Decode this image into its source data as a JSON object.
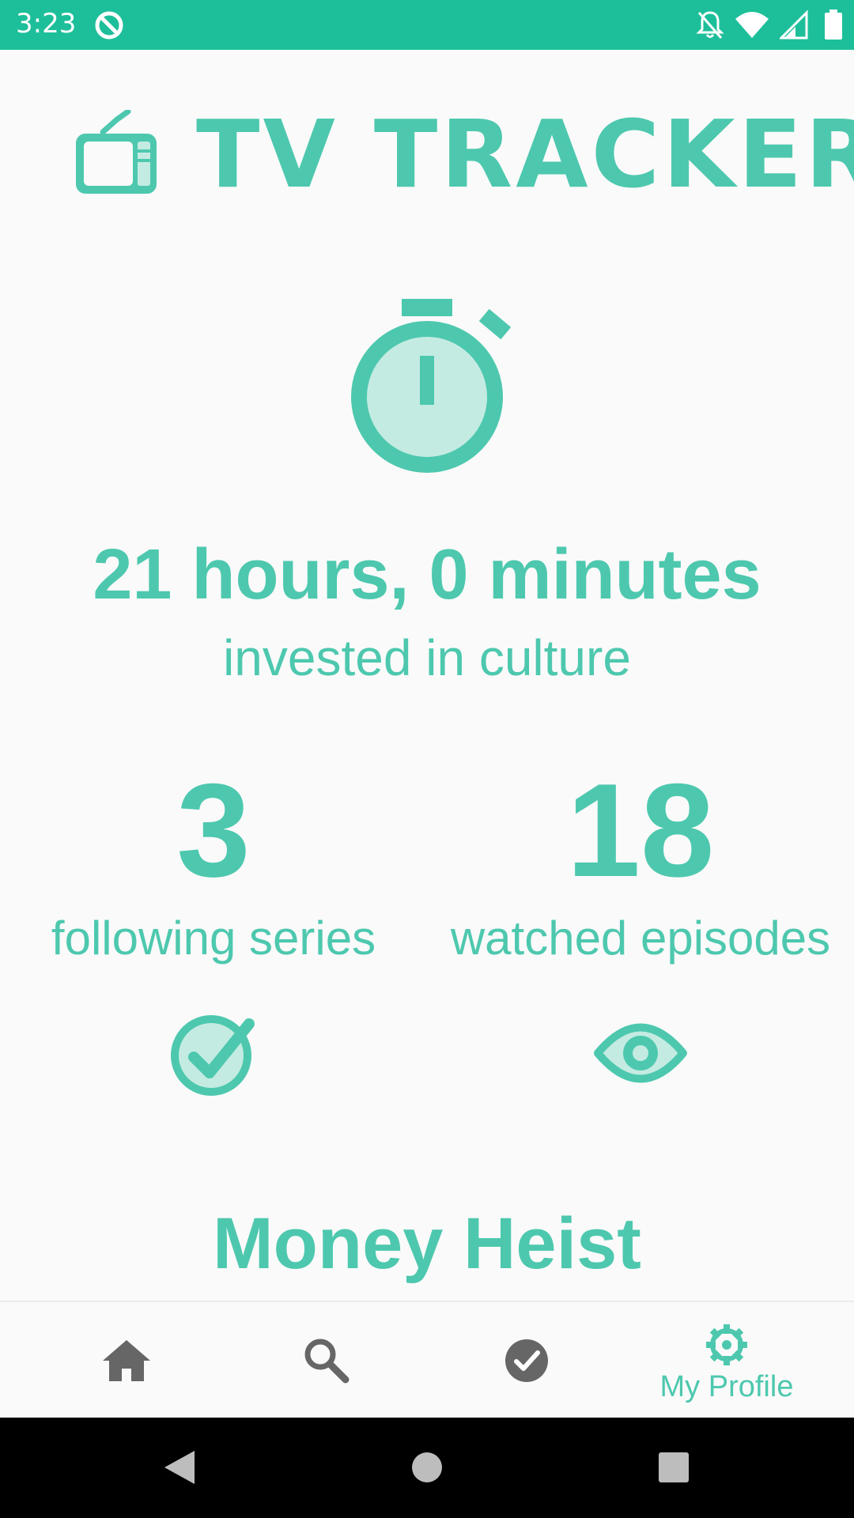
{
  "status_bar": {
    "time": "3:23",
    "icons": [
      "sync-icon",
      "notifications-off-icon",
      "wifi-icon",
      "cell-signal-icon",
      "battery-icon"
    ]
  },
  "header": {
    "title": "TV TRACKER",
    "logo_icon": "tv-icon"
  },
  "time_stats": {
    "icon": "stopwatch-icon",
    "value": "21 hours, 0 minutes",
    "caption": "invested in culture"
  },
  "stats": [
    {
      "number": "3",
      "label": "following series",
      "icon": "check-circle-icon"
    },
    {
      "number": "18",
      "label": "watched episodes",
      "icon": "eye-icon"
    }
  ],
  "featured": {
    "title": "Money Heist"
  },
  "bottom_nav": {
    "items": [
      {
        "icon": "home-icon",
        "label": "",
        "active": false
      },
      {
        "icon": "search-icon",
        "label": "",
        "active": false
      },
      {
        "icon": "check-circle-icon",
        "label": "",
        "active": false
      },
      {
        "icon": "gear-icon",
        "label": "My Profile",
        "active": true
      }
    ]
  },
  "colors": {
    "accent": "#4dc8ae",
    "accent_light": "#c4ebe2",
    "status_bar": "#1dbf9a",
    "inactive_icon": "#666666"
  }
}
